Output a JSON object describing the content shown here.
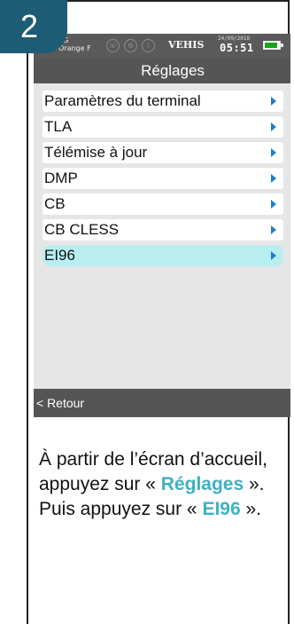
{
  "step": {
    "number": "2"
  },
  "status_bar": {
    "network": "3G",
    "carrier": "Orange F",
    "icons": [
      "phone-icon",
      "settings-icon",
      "info-icon"
    ],
    "terminal_name": "VEHIS",
    "date": "24/09/2018",
    "time": "05:51",
    "battery_level": 0.9,
    "battery_color": "#19a319"
  },
  "screen": {
    "title": "Réglages",
    "menu_items": [
      {
        "label": "Paramètres du terminal"
      },
      {
        "label": "TLA"
      },
      {
        "label": "Télémise à jour"
      },
      {
        "label": "DMP"
      },
      {
        "label": "CB"
      },
      {
        "label": "CB CLESS"
      },
      {
        "label": "EI96",
        "selected": true
      }
    ],
    "back_label": "< Retour"
  },
  "instructions": {
    "text_before": "À partir de l’écran d’accueil, appuyez sur « ",
    "highlight_1": "Réglages",
    "text_middle": " ». Puis appuyez sur « ",
    "highlight_2": "EI96",
    "text_after": " »."
  },
  "colors": {
    "badge": "#1e5b75",
    "highlight": "#3fb0c3",
    "selected_row": "#b9eef1",
    "arrow": "#1a7fd0"
  }
}
